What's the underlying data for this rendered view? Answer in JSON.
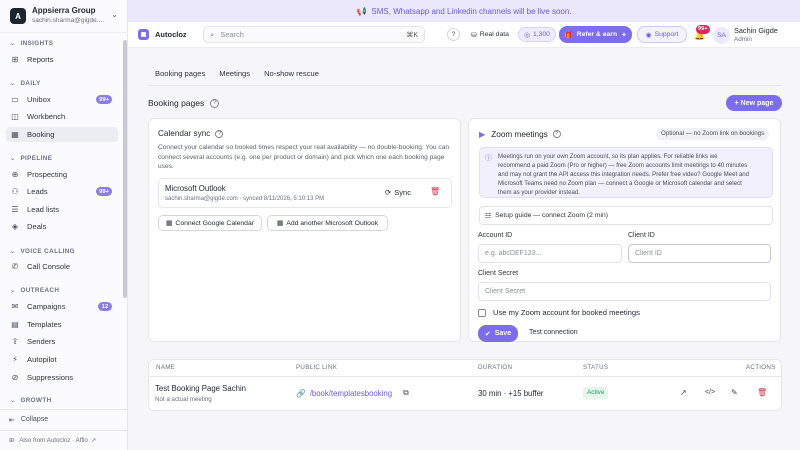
{
  "workspace": {
    "name": "Appsierra Group",
    "email": "sachin.sharma@gigde....",
    "logo_letter": "A"
  },
  "sidebar": {
    "sections": [
      {
        "label": "INSIGHTS"
      },
      {
        "label": "DAILY"
      },
      {
        "label": "PIPELINE"
      },
      {
        "label": "VOICE CALLING"
      },
      {
        "label": "OUTREACH"
      },
      {
        "label": "GROWTH"
      }
    ],
    "items": [
      {
        "label": "Reports",
        "icon": "chart-icon"
      },
      {
        "label": "Unibox",
        "icon": "inbox-icon",
        "badge": "99+"
      },
      {
        "label": "Workbench",
        "icon": "workbench-icon"
      },
      {
        "label": "Booking",
        "icon": "calendar-icon"
      },
      {
        "label": "Prospecting",
        "icon": "prospecting-icon"
      },
      {
        "label": "Leads",
        "icon": "users-icon",
        "badge": "99+"
      },
      {
        "label": "Lead lists",
        "icon": "list-icon"
      },
      {
        "label": "Deals",
        "icon": "deals-icon"
      },
      {
        "label": "Call Console",
        "icon": "phone-icon"
      },
      {
        "label": "Campaigns",
        "icon": "campaign-icon",
        "badge": "12"
      },
      {
        "label": "Templates",
        "icon": "template-icon"
      },
      {
        "label": "Senders",
        "icon": "sender-icon"
      },
      {
        "label": "Autopilot",
        "icon": "autopilot-icon"
      },
      {
        "label": "Suppressions",
        "icon": "suppression-icon"
      }
    ],
    "collapse_label": "Collapse",
    "also_from": "Also from Autocloz · Affio"
  },
  "banner": {
    "text": "SMS, Whatsapp and Linkedin channels will be live soon."
  },
  "topbar": {
    "brand": "Autocloz",
    "search_placeholder": "Search",
    "search_shortcut": "⌘K",
    "help": "?",
    "real_data": "Real data",
    "credits": "1,300",
    "refer": "Refer & earn",
    "support": "Support",
    "notif_badge": "99+",
    "avatar_initials": "SA",
    "user_name": "Sachin Gigde",
    "user_role": "Admin"
  },
  "tabs": [
    {
      "label": "Booking pages"
    },
    {
      "label": "Meetings"
    },
    {
      "label": "No-show rescue"
    }
  ],
  "page": {
    "title": "Booking pages",
    "new_page_button": "+ New page"
  },
  "calendar_sync": {
    "title": "Calendar sync",
    "description": "Connect your calendar so booked times respect your real availability — no double-booking. You can connect several accounts (e.g. one per product or domain) and pick which one each booking page uses.",
    "account": {
      "provider": "Microsoft Outlook",
      "detail": "sachin.sharma@gigde.com · synced 8/11/2026, 5:10:13 PM",
      "sync_label": "Sync"
    },
    "connect_google": "Connect Google Calendar",
    "add_outlook": "Add another Microsoft Outlook"
  },
  "zoom": {
    "title": "Zoom meetings",
    "optional_badge": "Optional — no Zoom link on bookings",
    "info_lines": [
      "Meetings run on your own Zoom account, so its plan applies. For reliable links we",
      "recommend a paid Zoom (Pro or higher) — free Zoom accounts limit meetings to 40 minutes",
      "and may not grant the API access this integration needs. Prefer free video? Google Meet and",
      "Microsoft Teams need no Zoom plan — connect a Google or Microsoft calendar and select",
      "them as your provider instead."
    ],
    "setup_guide": "Setup guide — connect Zoom (2 min)",
    "account_id_label": "Account ID",
    "account_id_placeholder": "e.g. abcDEF123...",
    "client_id_label": "Client ID",
    "client_id_placeholder": "Client ID",
    "client_secret_label": "Client Secret",
    "client_secret_placeholder": "Client Secret",
    "use_zoom_label": "Use my Zoom account for booked meetings",
    "save_label": "Save",
    "test_label": "Test connection"
  },
  "table": {
    "headers": [
      "NAME",
      "PUBLIC LINK",
      "DURATION",
      "STATUS",
      "ACTIONS"
    ],
    "rows": [
      {
        "name": "Test Booking Page Sachin",
        "subtitle": "Not a actual meeting",
        "link": "/book/templatesbooking",
        "duration": "30 min · +15 buffer",
        "status": "Active"
      }
    ]
  },
  "colors": {
    "accent": "#7c6cf0",
    "banner_bg": "#ebe8fc",
    "active_green": "#1f9d55"
  }
}
